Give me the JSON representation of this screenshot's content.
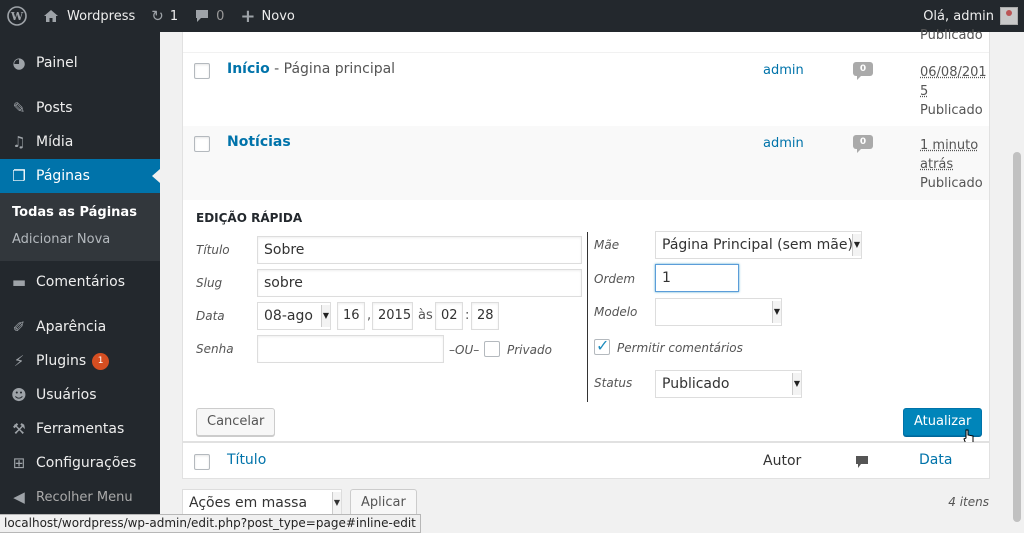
{
  "adminbar": {
    "site_name": "Wordpress",
    "updates_count": "1",
    "comments_count": "0",
    "new_label": "Novo",
    "greeting": "Olá, admin"
  },
  "sidebar": {
    "items": [
      {
        "label": "Painel",
        "icon": "dashboard-icon"
      },
      {
        "label": "Posts",
        "icon": "pin-icon"
      },
      {
        "label": "Mídia",
        "icon": "media-icon"
      },
      {
        "label": "Páginas",
        "icon": "pages-icon"
      },
      {
        "label": "Comentários",
        "icon": "comment-icon"
      },
      {
        "label": "Aparência",
        "icon": "brush-icon"
      },
      {
        "label": "Plugins",
        "icon": "plugin-icon"
      },
      {
        "label": "Usuários",
        "icon": "users-icon"
      },
      {
        "label": "Ferramentas",
        "icon": "wrench-icon"
      },
      {
        "label": "Configurações",
        "icon": "settings-icon"
      }
    ],
    "submenu": [
      "Todas as Páginas",
      "Adicionar Nova"
    ],
    "plugins_badge": "1",
    "collapse_label": "Recolher Menu"
  },
  "list": {
    "partial_status": "Publicado",
    "rows": [
      {
        "title": "Início",
        "suffix": " - Página principal",
        "author": "admin",
        "comments": "0",
        "date_line1": "06/08/201",
        "date_line2": "5",
        "status": "Publicado"
      },
      {
        "title": "Notícias",
        "suffix": "",
        "author": "admin",
        "comments": "0",
        "date_line1": "1 minuto",
        "date_line2": "atrás",
        "status": "Publicado"
      }
    ],
    "footer": {
      "title": "Título",
      "author": "Autor",
      "date": "Data"
    }
  },
  "quick_edit": {
    "heading": "EDIÇÃO RÁPIDA",
    "title_label": "Título",
    "title_value": "Sobre",
    "slug_label": "Slug",
    "slug_value": "sobre",
    "date_label": "Data",
    "month": "08-ago",
    "day": "16",
    "year": "2015",
    "at_label": "às",
    "hour": "02",
    "minute": "28",
    "password_label": "Senha",
    "or_label": "–OU–",
    "private_label": "Privado",
    "parent_label": "Mãe",
    "parent_value": "Página Principal (sem mãe)",
    "order_label": "Ordem",
    "order_value": "1",
    "template_label": "Modelo",
    "template_value": "",
    "allow_comments_label": "Permitir comentários",
    "status_label": "Status",
    "status_value": "Publicado",
    "cancel_label": "Cancelar",
    "update_label": "Atualizar"
  },
  "bottom": {
    "bulk_actions": "Ações em massa",
    "apply_label": "Aplicar",
    "items_count": "4 itens"
  },
  "statusbar": {
    "url": "localhost/wordpress/wp-admin/edit.php?post_type=page#inline-edit"
  },
  "colors": {
    "accent": "#0073aa",
    "primary_button": "#0085ba",
    "adminbar": "#23282d",
    "badge": "#d54e21"
  }
}
